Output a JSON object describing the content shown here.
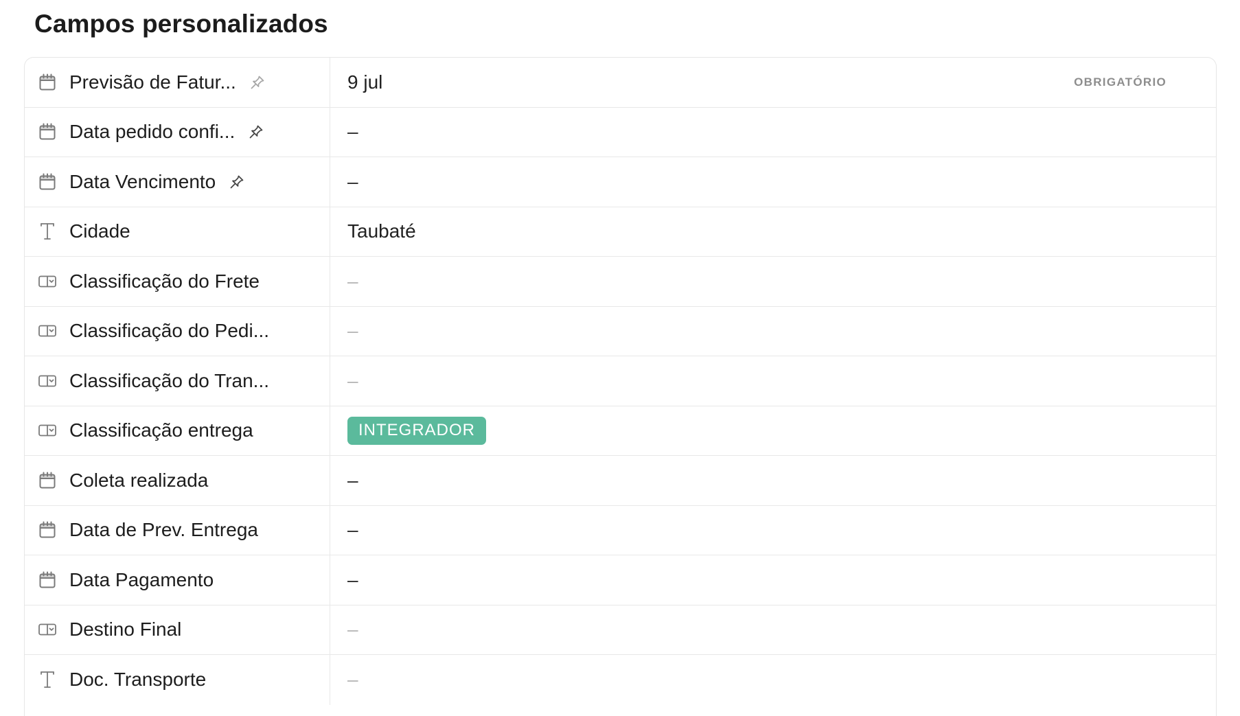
{
  "page": {
    "title": "Campos personalizados"
  },
  "fields": [
    {
      "icon": "calendar-icon",
      "label": "Previsão de Fatur...",
      "pin": "faded",
      "value": "9 jul",
      "value_style": "normal",
      "required": "OBRIGATÓRIO"
    },
    {
      "icon": "calendar-icon",
      "label": "Data pedido confi...",
      "pin": "dark",
      "value": "–",
      "value_style": "dash-dark"
    },
    {
      "icon": "calendar-icon",
      "label": "Data Vencimento",
      "pin": "dark",
      "value": "–",
      "value_style": "dash-dark"
    },
    {
      "icon": "text-icon",
      "label": "Cidade",
      "value": "Taubaté",
      "value_style": "normal"
    },
    {
      "icon": "dropdown-icon",
      "label": "Classificação do Frete",
      "value": "–",
      "value_style": "dash-light"
    },
    {
      "icon": "dropdown-icon",
      "label": "Classificação do Pedi...",
      "value": "–",
      "value_style": "dash-light"
    },
    {
      "icon": "dropdown-icon",
      "label": "Classificação do Tran...",
      "value": "–",
      "value_style": "dash-light"
    },
    {
      "icon": "dropdown-icon",
      "label": "Classificação entrega",
      "tag": "INTEGRADOR",
      "tag_color": "#5bba9c"
    },
    {
      "icon": "calendar-icon",
      "label": "Coleta realizada",
      "value": "–",
      "value_style": "dash-dark"
    },
    {
      "icon": "calendar-icon",
      "label": "Data de Prev. Entrega",
      "value": "–",
      "value_style": "dash-dark"
    },
    {
      "icon": "calendar-icon",
      "label": "Data Pagamento",
      "value": "–",
      "value_style": "dash-dark"
    },
    {
      "icon": "dropdown-icon",
      "label": "Destino Final",
      "value": "–",
      "value_style": "dash-light"
    },
    {
      "icon": "text-icon",
      "label": "Doc. Transporte",
      "value": "–",
      "value_style": "dash-light"
    }
  ]
}
